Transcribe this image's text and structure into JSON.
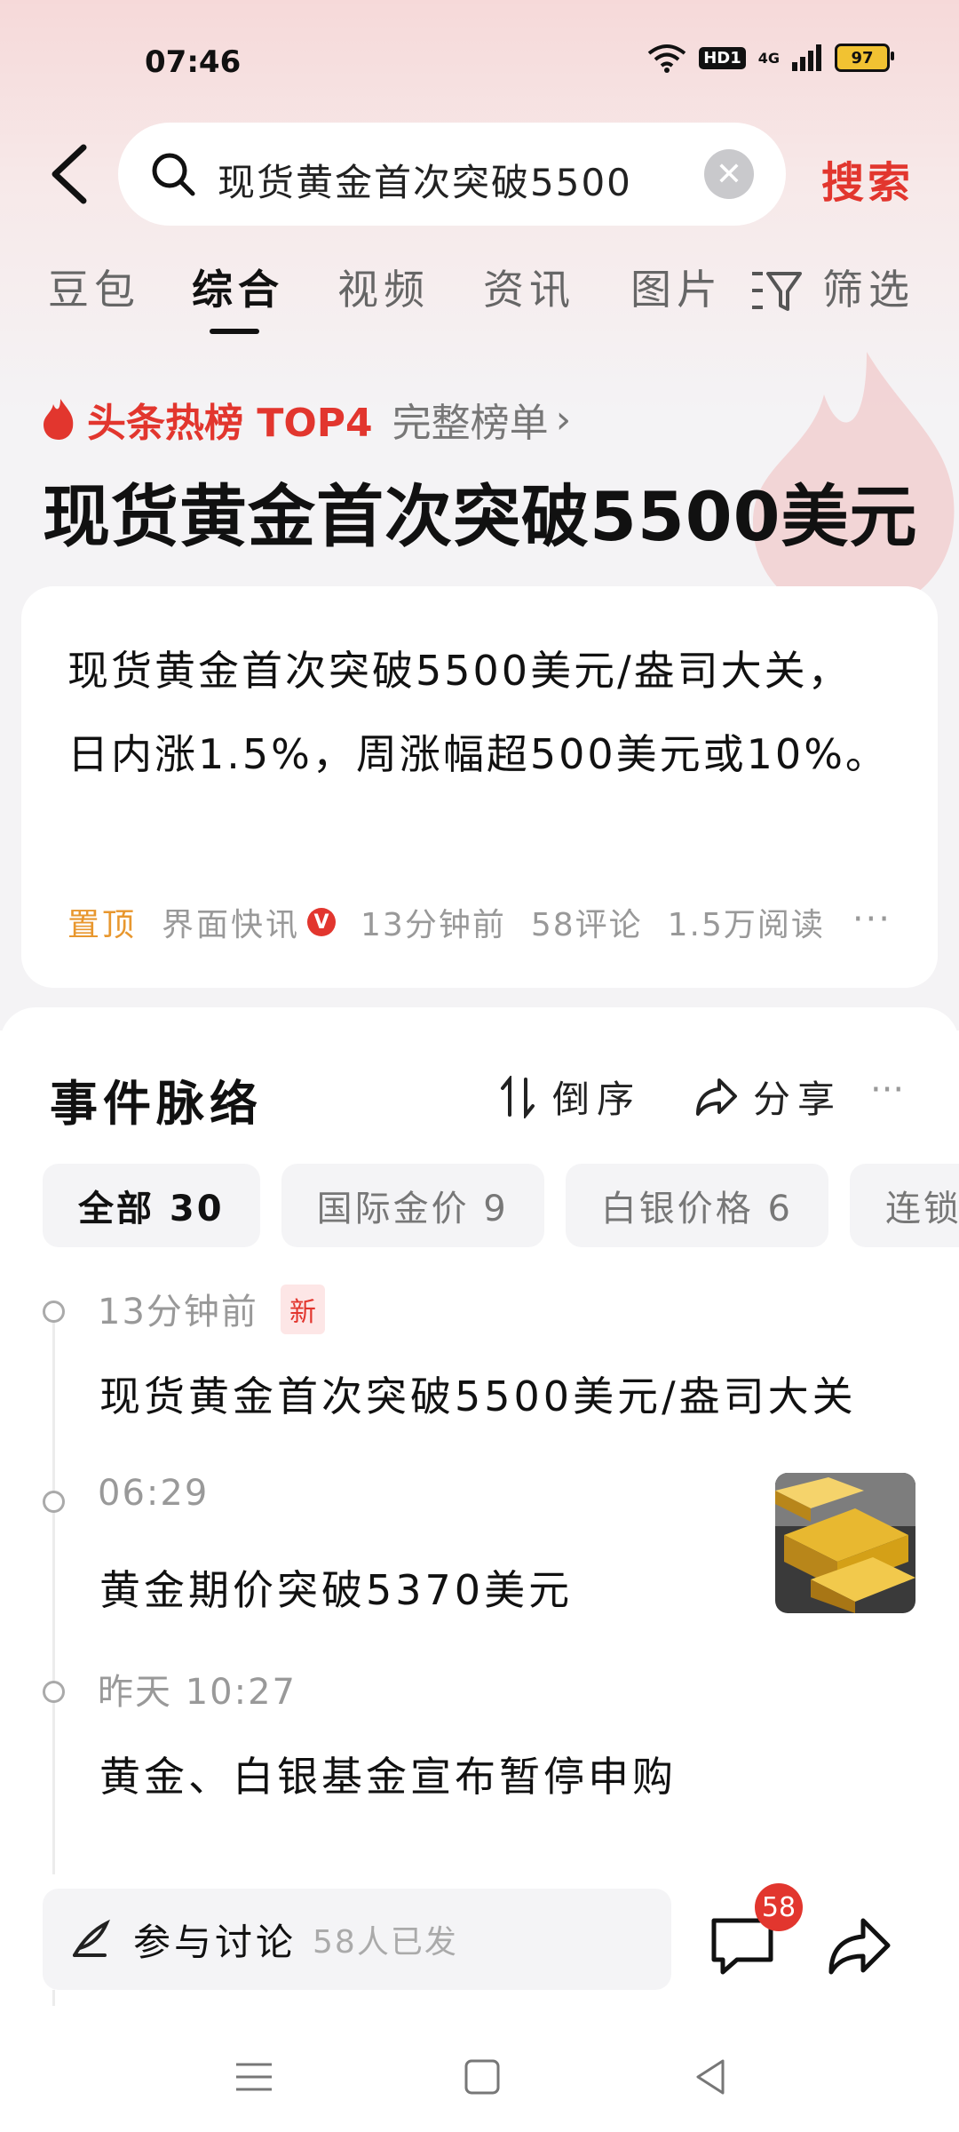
{
  "status_bar": {
    "time": "07:46",
    "hd_label": "HD1",
    "network_label": "4G",
    "battery": "97"
  },
  "search": {
    "query": "现货黄金首次突破5500",
    "action_label": "搜索"
  },
  "tabs": [
    {
      "label": "豆包"
    },
    {
      "label": "综合"
    },
    {
      "label": "视频"
    },
    {
      "label": "资讯"
    },
    {
      "label": "图片"
    },
    {
      "label": "筛选"
    }
  ],
  "hot": {
    "label": "头条热榜 TOP4",
    "full_list_label": "完整榜单",
    "chevron": "›"
  },
  "headline": "现货黄金首次突破5500美元",
  "summary": {
    "text": "现货黄金首次突破5500美元/盎司大关，日内涨1.5%，周涨幅超500美元或10%。",
    "pin_tag": "置顶",
    "source": "界面快讯",
    "verified": "V",
    "time": "13分钟前",
    "comments": "58评论",
    "reads": "1.5万阅读",
    "more": "···"
  },
  "timeline": {
    "title": "事件脉络",
    "sort_label": "倒序",
    "share_label": "分享",
    "more": "···",
    "chips": [
      {
        "label": "全部 30"
      },
      {
        "label": "国际金价 9"
      },
      {
        "label": "白银价格 6"
      },
      {
        "label": "连锁"
      }
    ],
    "items": [
      {
        "time": "13分钟前",
        "tag": "新",
        "title": "现货黄金首次突破5500美元/盎司大关"
      },
      {
        "time": "06:29",
        "title": "黄金期价突破5370美元"
      },
      {
        "time": "昨天 10:27",
        "title": "黄金、白银基金宣布暂停申购"
      }
    ]
  },
  "bottom": {
    "discuss_label": "参与讨论",
    "discuss_count": "58人已发",
    "comment_badge": "58"
  },
  "colors": {
    "accent_red": "#e2362e",
    "pin_orange": "#e8972e",
    "gold": "#d4a017"
  }
}
